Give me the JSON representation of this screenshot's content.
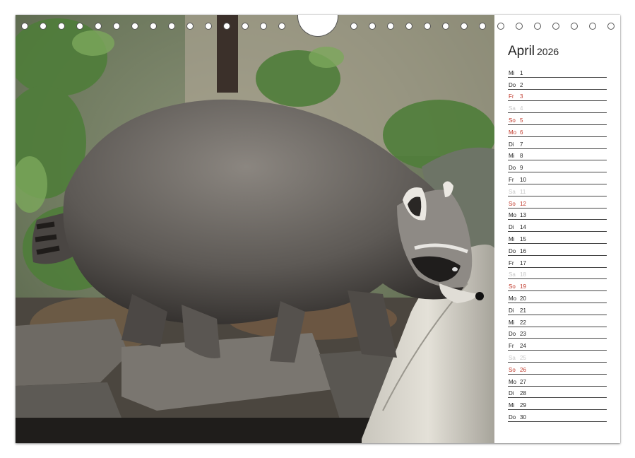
{
  "calendar": {
    "month": "April",
    "year": "2026",
    "days": [
      {
        "name": "Mi",
        "num": "1",
        "type": "normal"
      },
      {
        "name": "Do",
        "num": "2",
        "type": "normal"
      },
      {
        "name": "Fr",
        "num": "3",
        "type": "red"
      },
      {
        "name": "Sa",
        "num": "4",
        "type": "sat"
      },
      {
        "name": "So",
        "num": "5",
        "type": "red"
      },
      {
        "name": "Mo",
        "num": "6",
        "type": "red"
      },
      {
        "name": "Di",
        "num": "7",
        "type": "normal"
      },
      {
        "name": "Mi",
        "num": "8",
        "type": "normal"
      },
      {
        "name": "Do",
        "num": "9",
        "type": "normal"
      },
      {
        "name": "Fr",
        "num": "10",
        "type": "normal"
      },
      {
        "name": "Sa",
        "num": "11",
        "type": "sat"
      },
      {
        "name": "So",
        "num": "12",
        "type": "red"
      },
      {
        "name": "Mo",
        "num": "13",
        "type": "normal"
      },
      {
        "name": "Di",
        "num": "14",
        "type": "normal"
      },
      {
        "name": "Mi",
        "num": "15",
        "type": "normal"
      },
      {
        "name": "Do",
        "num": "16",
        "type": "normal"
      },
      {
        "name": "Fr",
        "num": "17",
        "type": "normal"
      },
      {
        "name": "Sa",
        "num": "18",
        "type": "sat"
      },
      {
        "name": "So",
        "num": "19",
        "type": "red"
      },
      {
        "name": "Mo",
        "num": "20",
        "type": "normal"
      },
      {
        "name": "Di",
        "num": "21",
        "type": "normal"
      },
      {
        "name": "Mi",
        "num": "22",
        "type": "normal"
      },
      {
        "name": "Do",
        "num": "23",
        "type": "normal"
      },
      {
        "name": "Fr",
        "num": "24",
        "type": "normal"
      },
      {
        "name": "Sa",
        "num": "25",
        "type": "sat"
      },
      {
        "name": "So",
        "num": "26",
        "type": "red"
      },
      {
        "name": "Mo",
        "num": "27",
        "type": "normal"
      },
      {
        "name": "Di",
        "num": "28",
        "type": "normal"
      },
      {
        "name": "Mi",
        "num": "29",
        "type": "normal"
      },
      {
        "name": "Do",
        "num": "30",
        "type": "normal"
      }
    ]
  },
  "colors": {
    "holiday_red": "#c0392b",
    "saturday_grey": "#c8c8c8",
    "text": "#222222"
  }
}
